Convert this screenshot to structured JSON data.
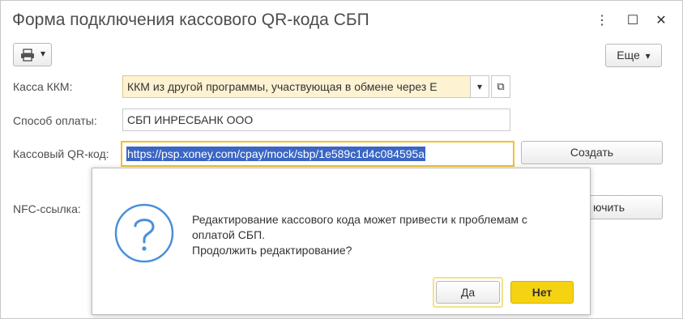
{
  "window": {
    "title": "Форма подключения кассового QR-кода СБП",
    "controls": {
      "more": "⋮",
      "maximize": "☐",
      "close": "✕"
    }
  },
  "toolbar": {
    "print_icon": "printer-icon",
    "print_dropdown": "▾",
    "more_label": "Еще",
    "more_dropdown": "▾"
  },
  "form": {
    "kassa": {
      "label": "Касса ККМ:",
      "value": "ККМ из другой программы, участвующая в обмене через E",
      "dropdown": "▾",
      "open": "⧉"
    },
    "payment_method": {
      "label": "Способ оплаты:",
      "value": "СБП ИНРЕСБАНК ООО"
    },
    "qr_code": {
      "label": "Кассовый QR-код:",
      "value": "https://psp.xoney.com/cpay/mock/sbp/1e589c1d4c084595a",
      "create_label": "Создать"
    },
    "nfc": {
      "label": "NFC-ссылка:",
      "partial_button_label": "ючить"
    }
  },
  "dialog": {
    "icon": "question-icon",
    "message_line1": "Редактирование кассового кода может привести к проблемам с",
    "message_line2": "оплатой СБП.",
    "message_line3": "Продолжить редактирование?",
    "yes_label": "Да",
    "no_label": "Нет"
  },
  "colors": {
    "accent_yellow": "#f5d312",
    "highlight_border": "#f2c12e",
    "selection_blue": "#3a66c4",
    "kassa_bg": "#fdf2d2",
    "question_blue": "#4a90d9"
  }
}
